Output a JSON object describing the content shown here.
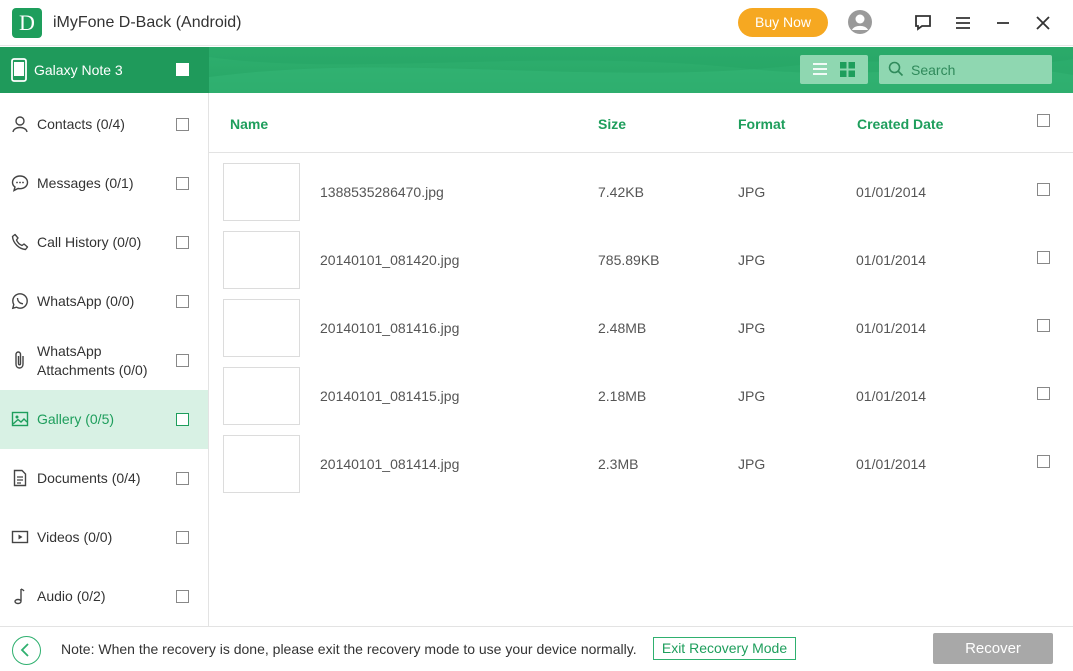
{
  "app": {
    "logo_letter": "D",
    "title": "iMyFone D-Back (Android)",
    "buy_label": "Buy Now",
    "brand_color": "#1e9e5c",
    "accent_color": "#f6a821"
  },
  "device": {
    "name": "Galaxy Note 3"
  },
  "search": {
    "placeholder": "Search"
  },
  "sidebar": {
    "items": [
      {
        "label": "Contacts (0/4)",
        "icon": "person-icon"
      },
      {
        "label": "Messages (0/1)",
        "icon": "chat-bubble-icon"
      },
      {
        "label": "Call History (0/0)",
        "icon": "phone-icon"
      },
      {
        "label": "WhatsApp (0/0)",
        "icon": "whatsapp-icon"
      },
      {
        "label": "WhatsApp",
        "label2": "Attachments (0/0)",
        "icon": "paperclip-icon"
      },
      {
        "label": "Gallery (0/5)",
        "icon": "image-icon",
        "active": true
      },
      {
        "label": "Documents (0/4)",
        "icon": "document-icon"
      },
      {
        "label": "Videos (0/0)",
        "icon": "video-icon"
      },
      {
        "label": "Audio (0/2)",
        "icon": "music-note-icon"
      }
    ]
  },
  "table": {
    "headers": {
      "name": "Name",
      "size": "Size",
      "format": "Format",
      "date": "Created Date"
    },
    "rows": [
      {
        "name": "1388535286470.jpg",
        "size": "7.42KB",
        "format": "JPG",
        "date": "01/01/2014"
      },
      {
        "name": "20140101_081420.jpg",
        "size": "785.89KB",
        "format": "JPG",
        "date": "01/01/2014"
      },
      {
        "name": "20140101_081416.jpg",
        "size": "2.48MB",
        "format": "JPG",
        "date": "01/01/2014"
      },
      {
        "name": "20140101_081415.jpg",
        "size": "2.18MB",
        "format": "JPG",
        "date": "01/01/2014"
      },
      {
        "name": "20140101_081414.jpg",
        "size": "2.3MB",
        "format": "JPG",
        "date": "01/01/2014"
      }
    ]
  },
  "footer": {
    "note": "Note: When the recovery is done, please exit the recovery mode to use your device normally.",
    "exit_label": "Exit Recovery Mode",
    "recover_label": "Recover"
  }
}
